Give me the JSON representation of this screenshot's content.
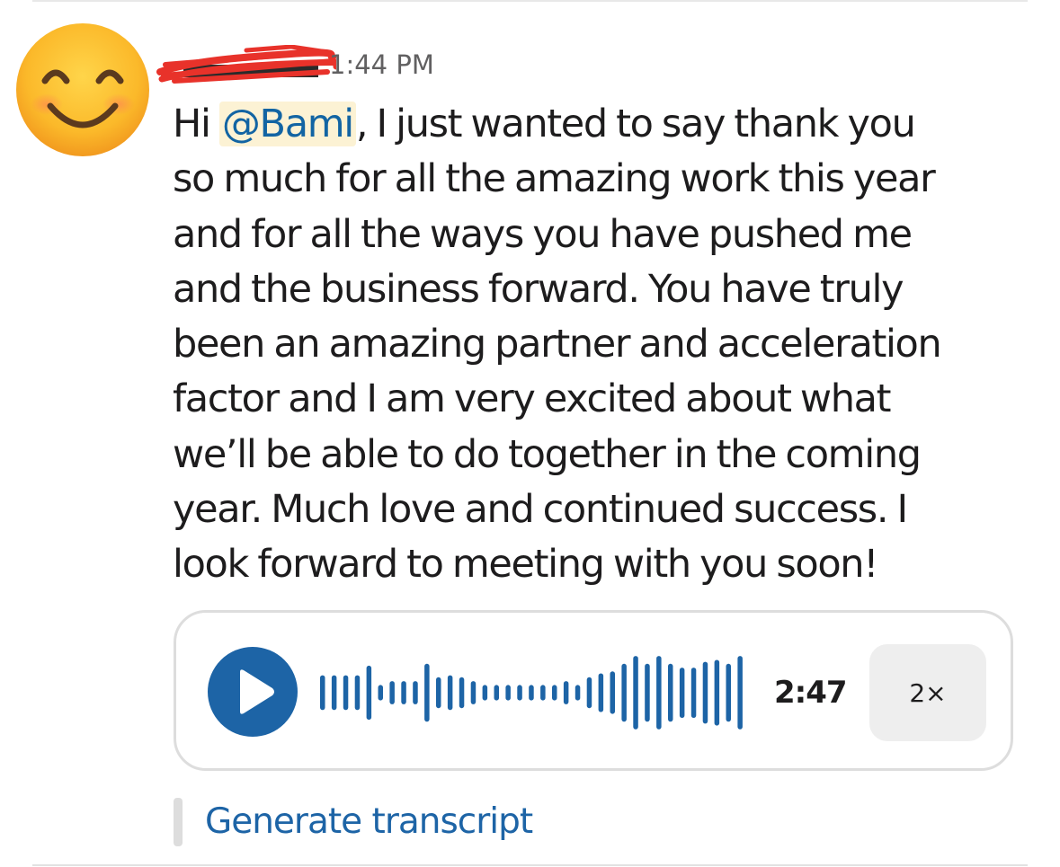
{
  "message": {
    "timestamp": "1:44 PM",
    "avatar_icon": "smiling-face-with-smiling-eyes-emoji",
    "greeting_prefix": "Hi ",
    "mention": "@Bami",
    "lines": {
      "line1_rest": ", I just wanted to say thank you",
      "line2": "so much for all the amazing work this year",
      "line3": "and for all the ways you have pushed me",
      "line4": "and the business forward. You have truly",
      "line5": "been an amazing partner and acceleration",
      "line6": "factor  and I am very excited about what",
      "line7": "we’ll be able to do together in the coming",
      "line8": "year. Much love and continued success. I",
      "line9": "look forward to meeting with you soon!"
    }
  },
  "audio": {
    "duration": "2:47",
    "speed": "2×",
    "play_icon": "play-icon",
    "accent_color": "#1d64a6",
    "waveform_levels": [
      0.45,
      0.45,
      0.45,
      0.45,
      0.7,
      0.2,
      0.3,
      0.3,
      0.3,
      0.75,
      0.4,
      0.45,
      0.4,
      0.3,
      0.2,
      0.2,
      0.2,
      0.2,
      0.2,
      0.2,
      0.2,
      0.3,
      0.2,
      0.4,
      0.5,
      0.55,
      0.75,
      0.95,
      0.75,
      0.95,
      0.75,
      0.65,
      0.65,
      0.8,
      0.85,
      0.75,
      0.95
    ]
  },
  "transcript": {
    "link_label": "Generate transcript"
  },
  "colors": {
    "mention_bg": "#fcf2d4",
    "mention_text": "#1264a3",
    "redaction": "#e8322a"
  }
}
